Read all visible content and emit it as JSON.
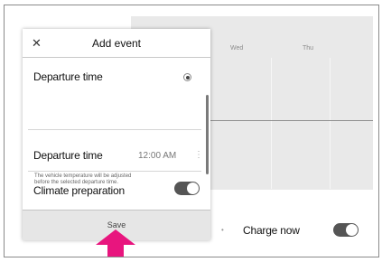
{
  "dialog": {
    "title": "Add event",
    "close_icon": "close-icon",
    "departure_header": "Departure time",
    "departure_time_label": "Departure time",
    "departure_time_value": "12:00 AM",
    "more_icon": "⋮",
    "climate_label": "Climate preparation",
    "climate_on": true,
    "climate_description": "The vehicle temperature will be adjusted before the selected departure time.",
    "save_label": "Save"
  },
  "calendar": {
    "days": [
      "Wed",
      "Thu"
    ]
  },
  "charge": {
    "label": "Charge now",
    "bullet": "•",
    "on": true
  },
  "colors": {
    "arrow": "#e8157e",
    "toggle_on": "#555555"
  }
}
